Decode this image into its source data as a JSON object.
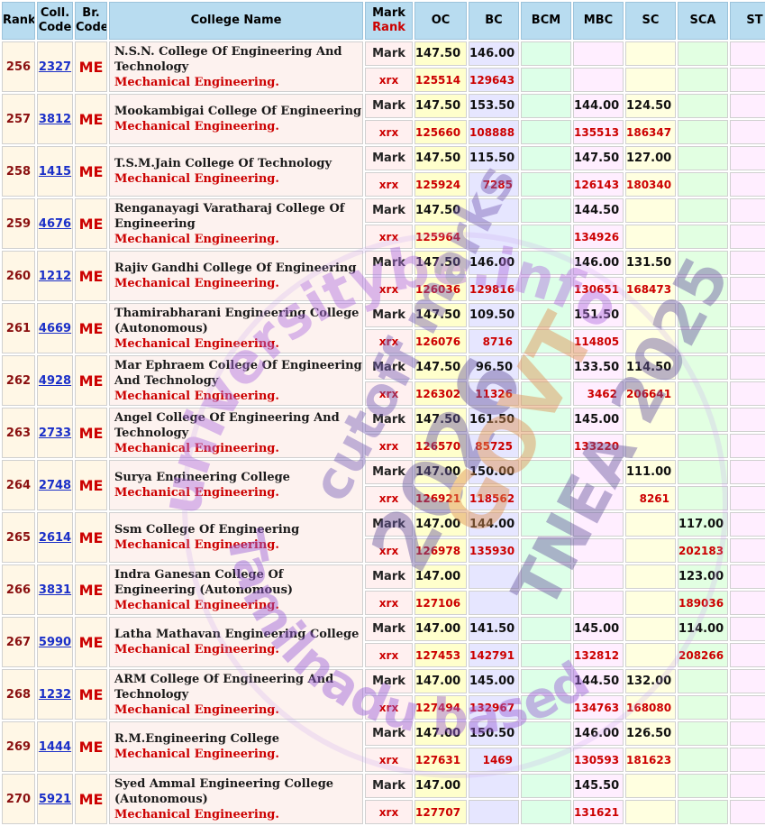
{
  "header": {
    "rank": "Rank",
    "coll_code_1": "Coll.",
    "coll_code_2": "Code",
    "br_code_1": "Br.",
    "br_code_2": "Code",
    "college_name": "College Name",
    "mark": "Mark",
    "rank_sub": "Rank",
    "oc": "OC",
    "bc": "BC",
    "bcm": "BCM",
    "mbc": "MBC",
    "sc": "SC",
    "sca": "SCA",
    "st": "ST"
  },
  "labels": {
    "mark": "Mark",
    "rank": "xrx"
  },
  "branch_code": "ME",
  "branch_name": "Mechanical Engineering.",
  "rows": [
    {
      "rank": "256",
      "code": "2327",
      "name": "N.S.N. College Of Engineering And Technology",
      "mark": {
        "oc": "147.50",
        "bc": "146.00",
        "bcm": "",
        "mbc": "",
        "sc": "",
        "sca": "",
        "st": ""
      },
      "rnk": {
        "oc": "125514",
        "bc": "129643",
        "bcm": "",
        "mbc": "",
        "sc": "",
        "sca": "",
        "st": ""
      }
    },
    {
      "rank": "257",
      "code": "3812",
      "name": "Mookambigai College Of Engineering",
      "mark": {
        "oc": "147.50",
        "bc": "153.50",
        "bcm": "",
        "mbc": "144.00",
        "sc": "124.50",
        "sca": "",
        "st": ""
      },
      "rnk": {
        "oc": "125660",
        "bc": "108888",
        "bcm": "",
        "mbc": "135513",
        "sc": "186347",
        "sca": "",
        "st": ""
      }
    },
    {
      "rank": "258",
      "code": "1415",
      "name": "T.S.M.Jain College Of Technology",
      "mark": {
        "oc": "147.50",
        "bc": "115.50",
        "bcm": "",
        "mbc": "147.50",
        "sc": "127.00",
        "sca": "",
        "st": ""
      },
      "rnk": {
        "oc": "125924",
        "bc": "7285",
        "bcm": "",
        "mbc": "126143",
        "sc": "180340",
        "sca": "",
        "st": ""
      }
    },
    {
      "rank": "259",
      "code": "4676",
      "name": "Renganayagi Varatharaj College Of Engineering",
      "mark": {
        "oc": "147.50",
        "bc": "",
        "bcm": "",
        "mbc": "144.50",
        "sc": "",
        "sca": "",
        "st": ""
      },
      "rnk": {
        "oc": "125964",
        "bc": "",
        "bcm": "",
        "mbc": "134926",
        "sc": "",
        "sca": "",
        "st": ""
      }
    },
    {
      "rank": "260",
      "code": "1212",
      "name": "Rajiv Gandhi College Of Engineering",
      "mark": {
        "oc": "147.50",
        "bc": "146.00",
        "bcm": "",
        "mbc": "146.00",
        "sc": "131.50",
        "sca": "",
        "st": ""
      },
      "rnk": {
        "oc": "126036",
        "bc": "129816",
        "bcm": "",
        "mbc": "130651",
        "sc": "168473",
        "sca": "",
        "st": ""
      }
    },
    {
      "rank": "261",
      "code": "4669",
      "name": "Thamirabharani Engineering College (Autonomous)",
      "mark": {
        "oc": "147.50",
        "bc": "109.50",
        "bcm": "",
        "mbc": "151.50",
        "sc": "",
        "sca": "",
        "st": ""
      },
      "rnk": {
        "oc": "126076",
        "bc": "8716",
        "bcm": "",
        "mbc": "114805",
        "sc": "",
        "sca": "",
        "st": ""
      }
    },
    {
      "rank": "262",
      "code": "4928",
      "name": "Mar Ephraem College Of Engineering And Technology",
      "mark": {
        "oc": "147.50",
        "bc": "96.50",
        "bcm": "",
        "mbc": "133.50",
        "sc": "114.50",
        "sca": "",
        "st": ""
      },
      "rnk": {
        "oc": "126302",
        "bc": "11326",
        "bcm": "",
        "mbc": "3462",
        "sc": "206641",
        "sca": "",
        "st": ""
      }
    },
    {
      "rank": "263",
      "code": "2733",
      "name": "Angel College Of Engineering And Technology",
      "mark": {
        "oc": "147.50",
        "bc": "161.50",
        "bcm": "",
        "mbc": "145.00",
        "sc": "",
        "sca": "",
        "st": ""
      },
      "rnk": {
        "oc": "126570",
        "bc": "85725",
        "bcm": "",
        "mbc": "133220",
        "sc": "",
        "sca": "",
        "st": ""
      }
    },
    {
      "rank": "264",
      "code": "2748",
      "name": "Surya Engineering College",
      "mark": {
        "oc": "147.00",
        "bc": "150.00",
        "bcm": "",
        "mbc": "",
        "sc": "111.00",
        "sca": "",
        "st": ""
      },
      "rnk": {
        "oc": "126921",
        "bc": "118562",
        "bcm": "",
        "mbc": "",
        "sc": "8261",
        "sca": "",
        "st": ""
      }
    },
    {
      "rank": "265",
      "code": "2614",
      "name": "Ssm College Of Engineering",
      "mark": {
        "oc": "147.00",
        "bc": "144.00",
        "bcm": "",
        "mbc": "",
        "sc": "",
        "sca": "117.00",
        "st": ""
      },
      "rnk": {
        "oc": "126978",
        "bc": "135930",
        "bcm": "",
        "mbc": "",
        "sc": "",
        "sca": "202183",
        "st": ""
      }
    },
    {
      "rank": "266",
      "code": "3831",
      "name": "Indra Ganesan College Of Engineering (Autonomous)",
      "mark": {
        "oc": "147.00",
        "bc": "",
        "bcm": "",
        "mbc": "",
        "sc": "",
        "sca": "123.00",
        "st": ""
      },
      "rnk": {
        "oc": "127106",
        "bc": "",
        "bcm": "",
        "mbc": "",
        "sc": "",
        "sca": "189036",
        "st": ""
      }
    },
    {
      "rank": "267",
      "code": "5990",
      "name": "Latha Mathavan Engineering College",
      "mark": {
        "oc": "147.00",
        "bc": "141.50",
        "bcm": "",
        "mbc": "145.00",
        "sc": "",
        "sca": "114.00",
        "st": ""
      },
      "rnk": {
        "oc": "127453",
        "bc": "142791",
        "bcm": "",
        "mbc": "132812",
        "sc": "",
        "sca": "208266",
        "st": ""
      }
    },
    {
      "rank": "268",
      "code": "1232",
      "name": "ARM College Of Engineering And Technology",
      "mark": {
        "oc": "147.00",
        "bc": "145.00",
        "bcm": "",
        "mbc": "144.50",
        "sc": "132.00",
        "sca": "",
        "st": ""
      },
      "rnk": {
        "oc": "127494",
        "bc": "132967",
        "bcm": "",
        "mbc": "134763",
        "sc": "168080",
        "sca": "",
        "st": ""
      }
    },
    {
      "rank": "269",
      "code": "1444",
      "name": "R.M.Engineering College",
      "mark": {
        "oc": "147.00",
        "bc": "150.50",
        "bcm": "",
        "mbc": "146.00",
        "sc": "126.50",
        "sca": "",
        "st": ""
      },
      "rnk": {
        "oc": "127631",
        "bc": "1469",
        "bcm": "",
        "mbc": "130593",
        "sc": "181623",
        "sca": "",
        "st": ""
      }
    },
    {
      "rank": "270",
      "code": "5921",
      "name": "Syed Ammal Engineering College (Autonomous)",
      "mark": {
        "oc": "147.00",
        "bc": "",
        "bcm": "",
        "mbc": "145.50",
        "sc": "",
        "sca": "",
        "st": ""
      },
      "rnk": {
        "oc": "127707",
        "bc": "",
        "bcm": "",
        "mbc": "131621",
        "sc": "",
        "sca": "",
        "st": ""
      }
    }
  ],
  "watermark": {
    "ring_top": "universitybe.info",
    "ring_bottom": "Tamilnadu based",
    "line1": "cutoff marks",
    "line2": "2026",
    "line3": "GOVT",
    "line4": "TNEA 2025",
    "color": "#b070e0"
  }
}
